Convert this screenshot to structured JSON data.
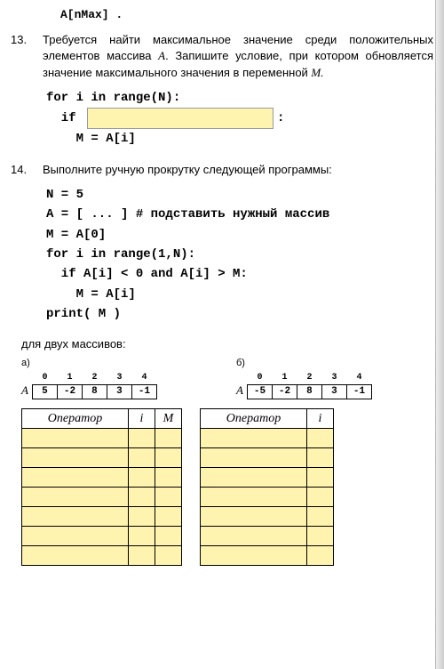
{
  "topFragment": "A[nMax] .",
  "task13": {
    "num": "13.",
    "text_a": "Требуется найти максимальное значение среди положительных элементов массива ",
    "var_a": "A",
    "text_b": ". Запишите условие, при котором обновляется значение максимального значения в переменной ",
    "var_m": "M.",
    "code": {
      "l1": "for i in range(N):",
      "l2a": "  if ",
      "l2b": ":",
      "l3": "    M = A[i]"
    }
  },
  "task14": {
    "num": "14.",
    "text": "Выполните ручную прокрутку следующей программы:",
    "code": {
      "l1": "N = 5",
      "l2": "A = [ ... ] # подставить нужный массив",
      "l3": "M = A[0]",
      "l4": "for i in range(1,N):",
      "l5": "  if A[i] < 0 and A[i] > M:",
      "l6": "    M = A[i]",
      "l7": "print( M )"
    },
    "for_two": "для двух массивов:"
  },
  "arrays": {
    "a": {
      "letter": "а)",
      "name": "A",
      "idx": [
        "0",
        "1",
        "2",
        "3",
        "4"
      ],
      "vals": [
        "5",
        "-2",
        "8",
        "3",
        "-1"
      ]
    },
    "b": {
      "letter": "б)",
      "name": "A",
      "idx": [
        "0",
        "1",
        "2",
        "3",
        "4"
      ],
      "vals": [
        "-5",
        "-2",
        "8",
        "3",
        "-1"
      ]
    }
  },
  "trace": {
    "a": {
      "headers": [
        "Оператор",
        "i",
        "M"
      ],
      "rows": 7
    },
    "b": {
      "headers": [
        "Оператор",
        "i"
      ],
      "rows": 7
    }
  }
}
